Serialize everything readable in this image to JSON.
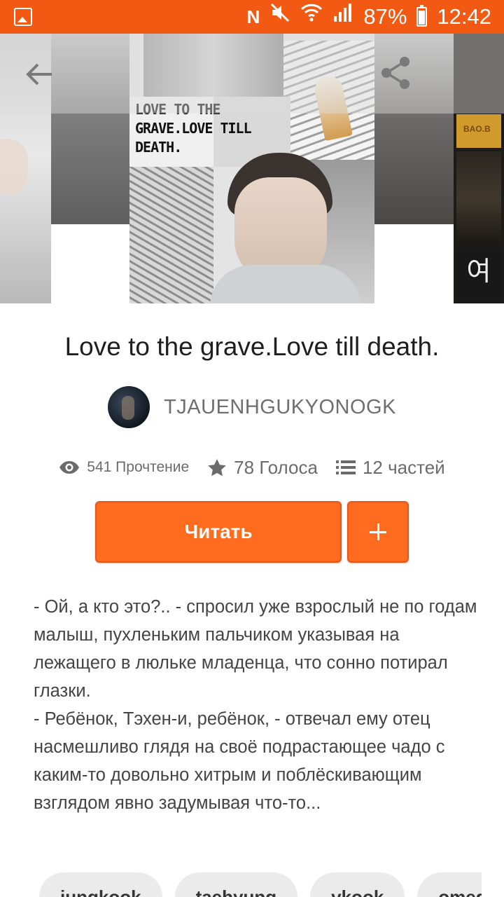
{
  "status_bar": {
    "battery_percent": "87%",
    "time": "12:42",
    "icons": [
      "gallery-icon",
      "nfc-icon",
      "mute-icon",
      "wifi-icon",
      "signal-icon",
      "battery-icon"
    ]
  },
  "cover": {
    "title_text": "LOVE TO THE\nGRAVE.LOVE TILL\nDEATH.",
    "next_cover_korean": "여"
  },
  "toolbar": {
    "icons": [
      "back-arrow-icon",
      "share-icon"
    ]
  },
  "story": {
    "title": "Love to the grave.Love till death.",
    "author": "TJAUENHGUKYONOGK",
    "reads": "541 Прочтение",
    "votes": "78 Голоса",
    "parts": "12 частей",
    "read_button": "Читать",
    "add_button_icon": "plus-icon",
    "description": [
      "- Ой, а кто это?.. - спросил уже взрослый не по годам малыш, пухленьким пальчиком указывая на лежащего в люльке младенца, что сонно потирал глазки.",
      "- Ребёнок, Тэхен-и, ребёнок, - отвечал ему отец насмешливо глядя на своё подрастающее чадо с каким-то довольно хитрым и поблёскивающим взглядом явно задумывая что-то..."
    ],
    "tags": [
      "jungkook",
      "taehyung",
      "vkook",
      "omega"
    ]
  },
  "colors": {
    "status_bar": "#f25a13",
    "accent": "#ff6c1f",
    "text_muted": "#6b6b6b"
  }
}
